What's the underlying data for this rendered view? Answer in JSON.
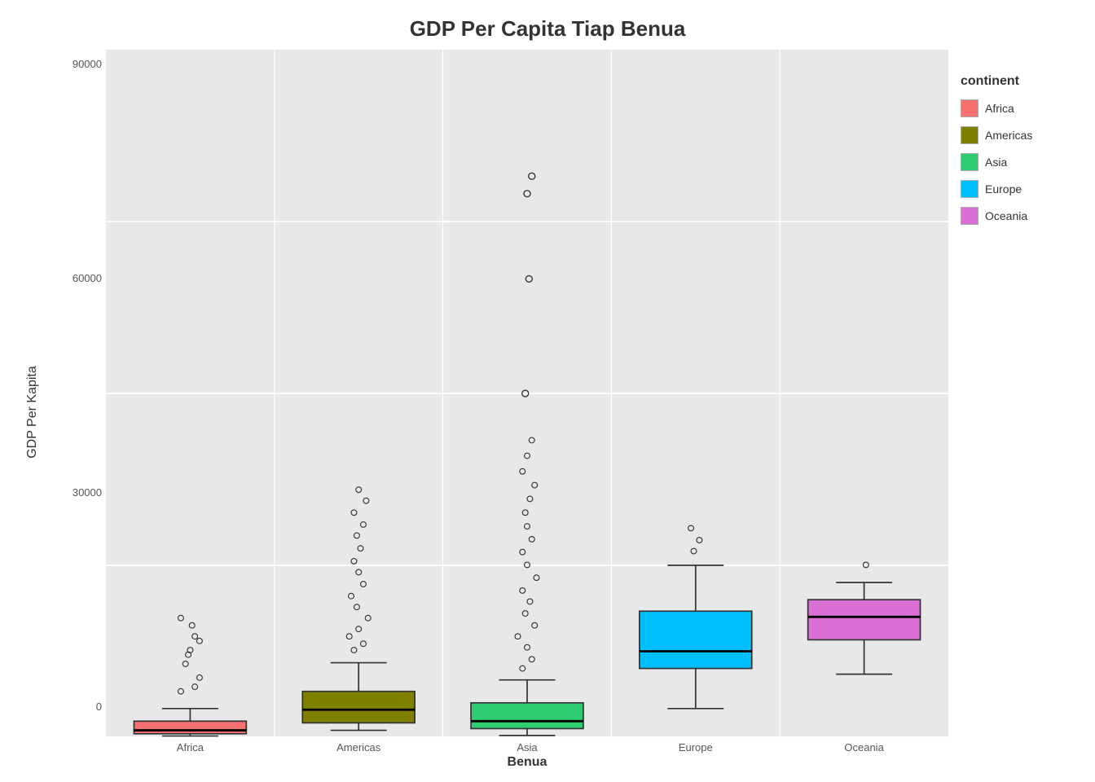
{
  "title": "GDP Per Capita Tiap Benua",
  "yAxisLabel": "GDP Per Kapita",
  "xAxisLabel": "Benua",
  "yTicks": [
    "0",
    "30000",
    "60000",
    "90000"
  ],
  "xTicks": [
    "Africa",
    "Americas",
    "Asia",
    "Europe",
    "Oceania"
  ],
  "legend": {
    "title": "continent",
    "items": [
      {
        "label": "Africa",
        "color": "#F87171"
      },
      {
        "label": "Americas",
        "color": "#808000"
      },
      {
        "label": "Asia",
        "color": "#2ECC71"
      },
      {
        "label": "Europe",
        "color": "#00BFFF"
      },
      {
        "label": "Oceania",
        "color": "#DA70D6"
      }
    ]
  },
  "colors": {
    "africa": "#F87171",
    "americas": "#808000",
    "asia": "#2ECC71",
    "europe": "#00BFFF",
    "oceania": "#DA70D6",
    "background": "#e8e8e8"
  }
}
